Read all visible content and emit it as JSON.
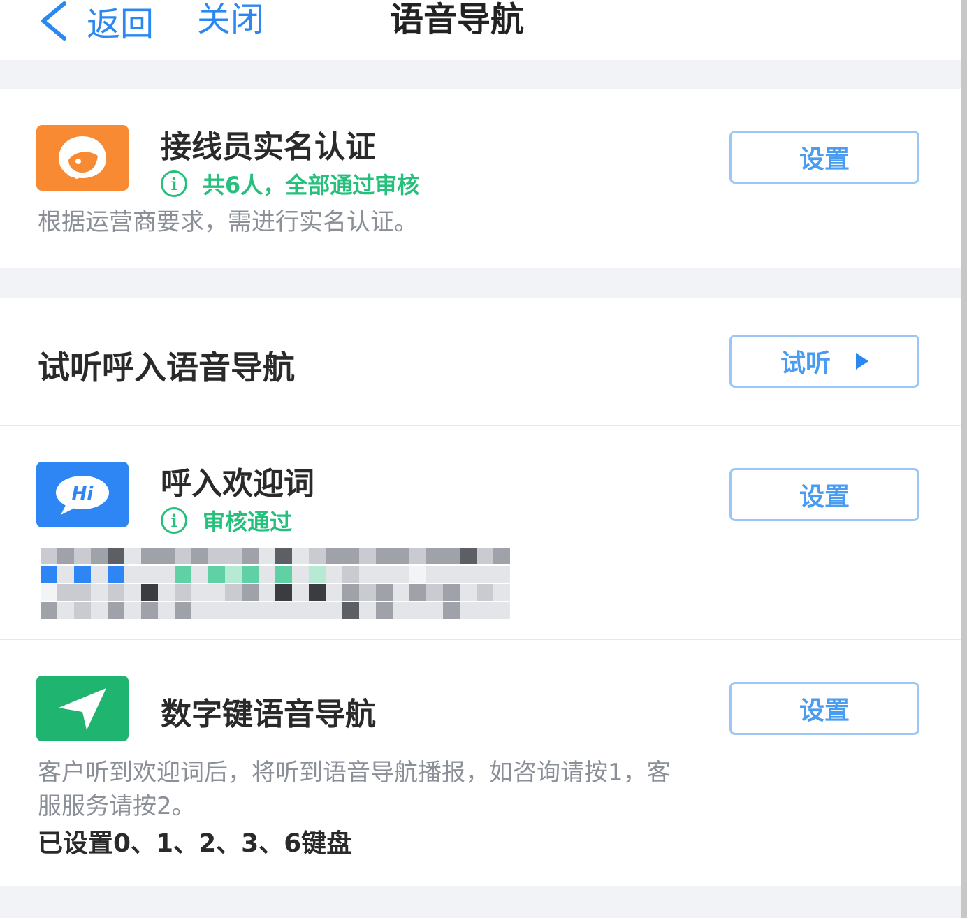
{
  "header": {
    "back_label": "返回",
    "close_label": "关闭",
    "title": "语音导航"
  },
  "verification": {
    "icon": "headset-agent-icon",
    "title": "接线员实名认证",
    "status": "共6人，全部通过审核",
    "description": "根据运营商要求，需进行实名认证。",
    "button_label": "设置"
  },
  "preview": {
    "title": "试听呼入语音导航",
    "button_label": "试听"
  },
  "welcome": {
    "icon": "hi-chat-bubble-icon",
    "icon_text": "Hi",
    "title": "呼入欢迎词",
    "status": "审核通过",
    "button_label": "设置"
  },
  "keypad": {
    "icon": "navigation-arrow-icon",
    "title": "数字键语音导航",
    "description_line1": "客户听到欢迎词后，将听到语音导航播报，如咨询请按1，客",
    "description_line2": "服服务请按2。",
    "configured_keys": "已设置0、1、2、3、6键盘",
    "button_label": "设置"
  },
  "colors": {
    "accent_blue": "#2b88f0",
    "success_green": "#25c07c",
    "orange_icon": "#f78a33",
    "blue_icon": "#2e86f5",
    "green_icon": "#1fb46f"
  }
}
